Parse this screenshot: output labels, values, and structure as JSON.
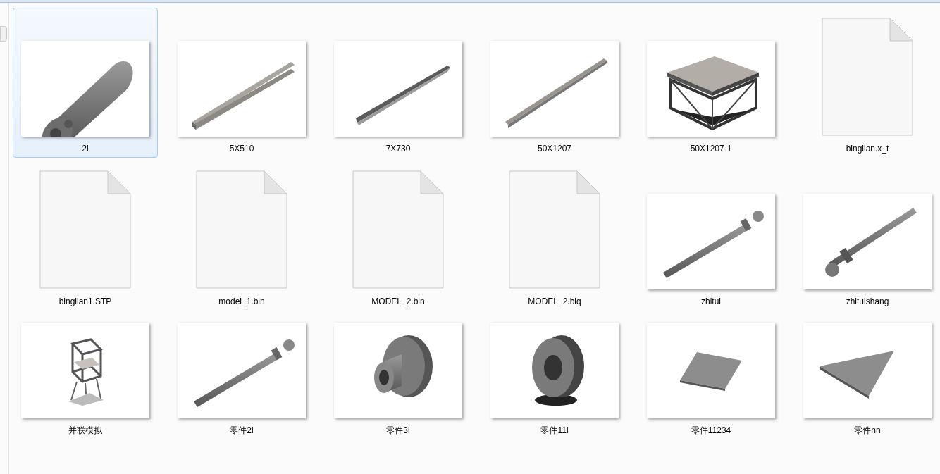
{
  "items": [
    {
      "name": "2l",
      "kind": "model",
      "selected": true
    },
    {
      "name": "5X510",
      "kind": "model",
      "selected": false
    },
    {
      "name": "7X730",
      "kind": "model",
      "selected": false
    },
    {
      "name": "50X1207",
      "kind": "model",
      "selected": false
    },
    {
      "name": "50X1207-1",
      "kind": "model",
      "selected": false
    },
    {
      "name": "binglian.x_t",
      "kind": "file",
      "selected": false
    },
    {
      "name": "binglian1.STP",
      "kind": "file",
      "selected": false
    },
    {
      "name": "model_1.bin",
      "kind": "file",
      "selected": false
    },
    {
      "name": "MODEL_2.bin",
      "kind": "file",
      "selected": false
    },
    {
      "name": "MODEL_2.biq",
      "kind": "file",
      "selected": false
    },
    {
      "name": "zhitui",
      "kind": "model",
      "selected": false
    },
    {
      "name": "zhituishang",
      "kind": "model",
      "selected": false
    },
    {
      "name": "并联模拟",
      "kind": "model",
      "selected": false
    },
    {
      "name": "零件2l",
      "kind": "model",
      "selected": false
    },
    {
      "name": "零件3l",
      "kind": "model",
      "selected": false
    },
    {
      "name": "零件11l",
      "kind": "model",
      "selected": false
    },
    {
      "name": "零件11234",
      "kind": "model",
      "selected": false
    },
    {
      "name": "零件nn",
      "kind": "model",
      "selected": false
    }
  ]
}
